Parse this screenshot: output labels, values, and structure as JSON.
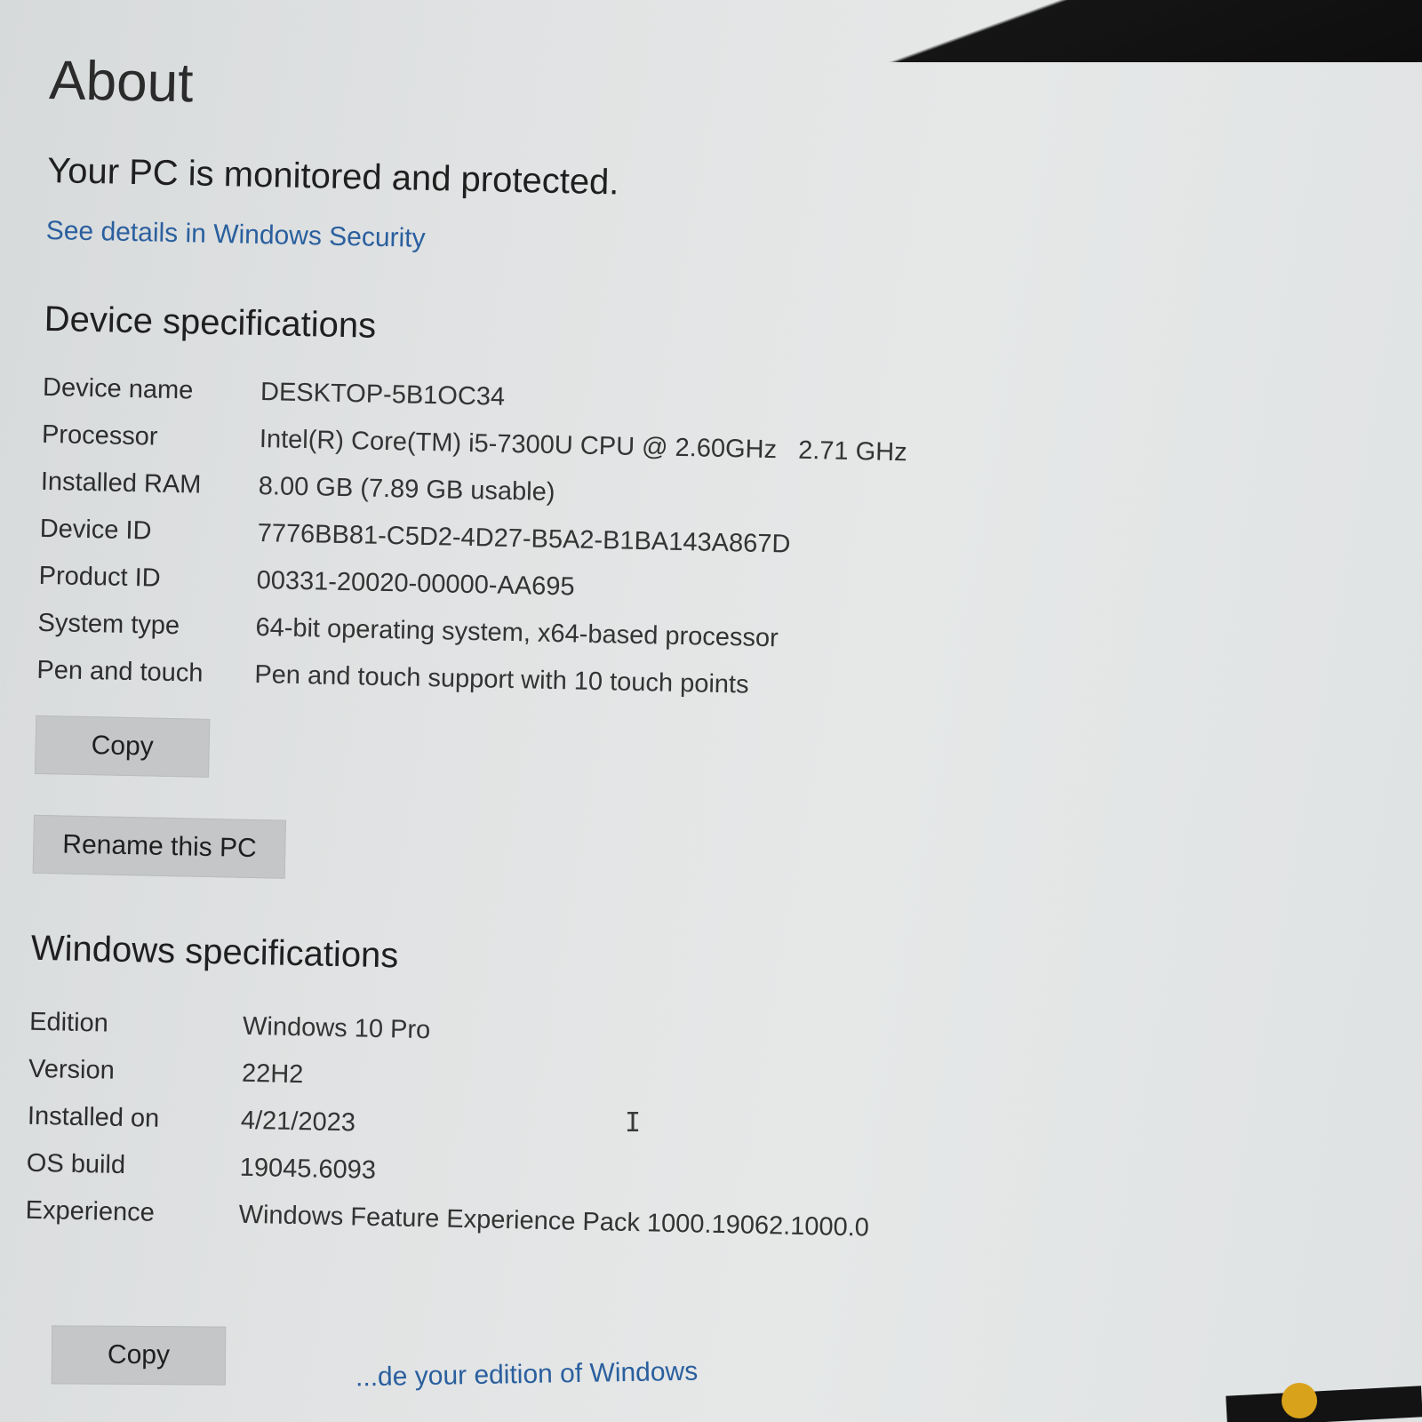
{
  "page": {
    "title": "About",
    "status": "Your PC is monitored and protected.",
    "security_link": "See details in Windows Security"
  },
  "device_specs": {
    "title": "Device specifications",
    "rows": [
      {
        "label": "Device name",
        "value": "DESKTOP-5B1OC34"
      },
      {
        "label": "Processor",
        "value": "Intel(R) Core(TM) i5-7300U CPU @ 2.60GHz   2.71 GHz"
      },
      {
        "label": "Installed RAM",
        "value": "8.00 GB (7.89 GB usable)"
      },
      {
        "label": "Device ID",
        "value": "7776BB81-C5D2-4D27-B5A2-B1BA143A867D"
      },
      {
        "label": "Product ID",
        "value": "00331-20020-00000-AA695"
      },
      {
        "label": "System type",
        "value": "64-bit operating system, x64-based processor"
      },
      {
        "label": "Pen and touch",
        "value": "Pen and touch support with 10 touch points"
      }
    ],
    "copy_label": "Copy",
    "rename_label": "Rename this PC"
  },
  "windows_specs": {
    "title": "Windows specifications",
    "rows": [
      {
        "label": "Edition",
        "value": "Windows 10 Pro"
      },
      {
        "label": "Version",
        "value": "22H2"
      },
      {
        "label": "Installed on",
        "value": "4/21/2023"
      },
      {
        "label": "OS build",
        "value": "19045.6093"
      },
      {
        "label": "Experience",
        "value": "Windows Feature Experience Pack 1000.19062.1000.0"
      }
    ],
    "copy_label": "Copy"
  },
  "bottom_link": "...de your edition of Windows",
  "cursor_glyph": "I"
}
